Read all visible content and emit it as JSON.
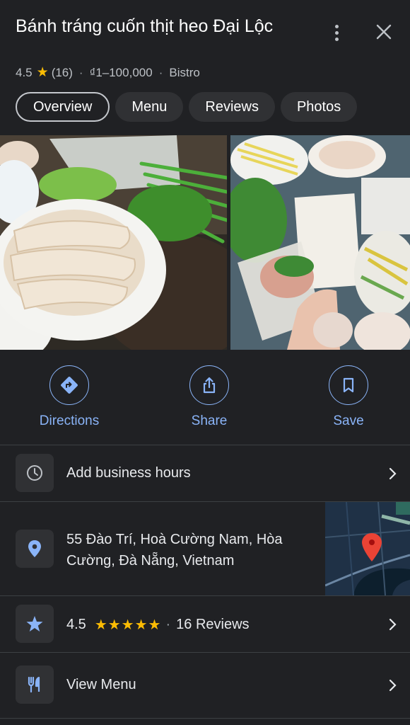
{
  "place": {
    "name": "Bánh tráng cuốn thịt heo Đại Lộc",
    "rating": "4.5",
    "review_count": "(16)",
    "price_range": "₫1–100,000",
    "category": "Bistro",
    "separator": "·"
  },
  "tabs": [
    {
      "label": "Overview",
      "active": true
    },
    {
      "label": "Menu",
      "active": false
    },
    {
      "label": "Reviews",
      "active": false
    },
    {
      "label": "Photos",
      "active": false
    }
  ],
  "actions": [
    {
      "label": "Directions",
      "icon": "directions-icon"
    },
    {
      "label": "Share",
      "icon": "share-icon"
    },
    {
      "label": "Save",
      "icon": "bookmark-icon"
    }
  ],
  "info_rows": {
    "hours": {
      "label": "Add business hours",
      "icon": "clock-icon"
    },
    "address": {
      "line1": "55 Đào Trí, Hoà Cường Nam, Hòa",
      "line2": "Cường, Đà Nẵng, Vietnam",
      "icon": "location-pin-icon"
    },
    "rating": {
      "value": "4.5",
      "stars": "★★★★★",
      "stars_value": 4.5,
      "separator": "·",
      "reviews": "16 Reviews",
      "icon": "star-icon"
    },
    "menu": {
      "label": "View Menu",
      "icon": "restaurant-icon"
    }
  },
  "colors": {
    "background": "#202124",
    "accent": "#8ab4f8",
    "star": "#fbbc04",
    "chip": "#303134",
    "map_pin": "#ea4335"
  }
}
